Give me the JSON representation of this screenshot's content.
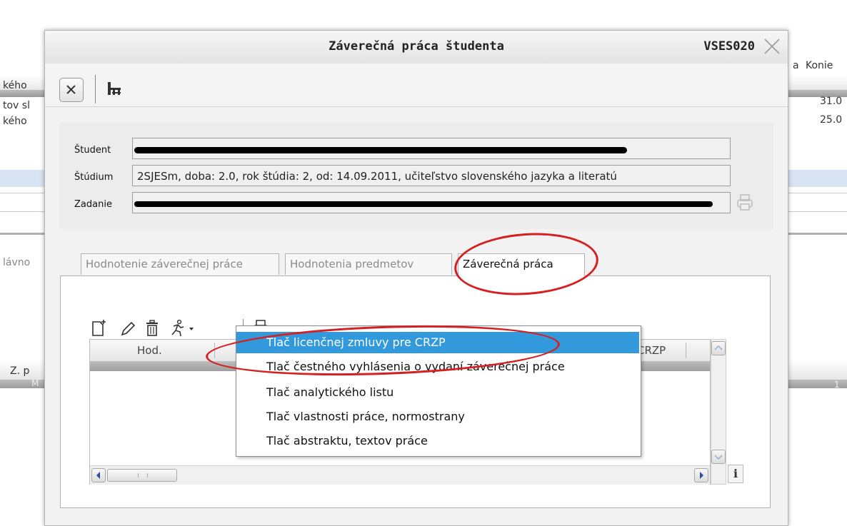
{
  "background": {
    "header_cells": [
      "a",
      "Konie"
    ],
    "left_rows": [
      "kého",
      "tov sl",
      "kého"
    ],
    "right_values": [
      "31.0",
      "25.0"
    ],
    "left_lower": [
      "lávno",
      "Z. p",
      "M"
    ],
    "right_lower": [
      "1"
    ]
  },
  "dialog": {
    "title": "Záverečná práca študenta",
    "code": "VSES020"
  },
  "toolbar": {
    "close_icon": "close-icon",
    "tree_icon": "org-tree-icon"
  },
  "fields": {
    "student_label": "Študent",
    "studium_label": "Štúdium",
    "studium_value": "2SJESm, doba: 2.0, rok štúdia: 2, od: 14.09.2011, učiteľstvo slovenského jazyka a literatú",
    "zadanie_label": "Zadanie",
    "print_icon": "printer-icon"
  },
  "tabs": [
    {
      "label": "Hodnotenie záverečnej práce",
      "active": false
    },
    {
      "label": "Hodnotenia predmetov",
      "active": false
    },
    {
      "label": "Záverečná práca",
      "active": true
    }
  ],
  "panel_tools": [
    "new-document-icon",
    "edit-pencil-icon",
    "delete-trash-icon",
    "action-runner-icon",
    "print-dropdown-icon"
  ],
  "grid": {
    "columns": [
      "Hod.",
      "CRZP"
    ],
    "info_label": "i"
  },
  "print_menu": {
    "items": [
      "Tlač licenčnej zmluvy pre CRZP",
      "Tlač čestného vyhlásenia o vydaní záverečnej práce",
      "Tlač analytického listu",
      "Tlač vlastnosti práce, normostrany",
      "Tlač abstraktu, textov práce"
    ],
    "selected_index": 0
  },
  "colors": {
    "menu_highlight": "#3399dd",
    "annotation": "#d42020"
  }
}
